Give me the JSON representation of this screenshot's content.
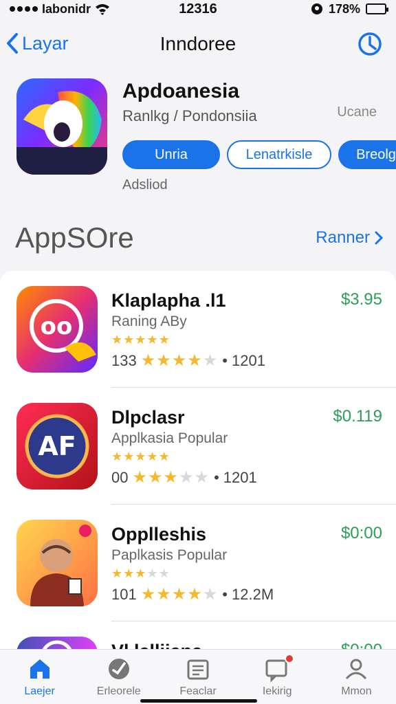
{
  "status_bar": {
    "carrier": "Iabonidr",
    "time": "12316",
    "battery": "178%",
    "battery_level": 0.9
  },
  "nav": {
    "back_label": "Layar",
    "title": "Inndoree"
  },
  "featured": {
    "name": "Apdoanesia",
    "subtitle": "Ranlkg / Pondonsiia",
    "extra": "Ucane",
    "buttons": [
      "Unria",
      "Lenatrkisle",
      "Breolg"
    ],
    "added": "Adsliod"
  },
  "section": {
    "title": "AppSOre",
    "see_all": "Ranner"
  },
  "apps": [
    {
      "name": "Klaplapha .l1",
      "category": "Raning ABy",
      "price": "$3.95",
      "stars_small": 5,
      "count": "133",
      "stars": 3.5,
      "reviews": "1201"
    },
    {
      "name": "Dlpclasr",
      "category": "Applkasia Popular",
      "price": "$0.119",
      "stars_small": 5,
      "count": "00",
      "stars": 2.5,
      "reviews": "1201"
    },
    {
      "name": "Opplleshis",
      "category": "Paplkasis Popular",
      "price": "$0:00",
      "stars_small": 3,
      "count": "101",
      "stars": 3.5,
      "reviews": "12.2M"
    },
    {
      "name": "Vl lelliiene",
      "category": "",
      "price": "$0:00"
    }
  ],
  "tabs": [
    {
      "label": "Laejer",
      "icon": "home-icon",
      "active": true
    },
    {
      "label": "Erleorele",
      "icon": "explore-icon"
    },
    {
      "label": "Feaclar",
      "icon": "news-icon"
    },
    {
      "label": "Iekirig",
      "icon": "inbox-icon",
      "badge": true
    },
    {
      "label": "Mmon",
      "icon": "profile-icon"
    }
  ],
  "colors": {
    "accent": "#1a73e8",
    "price": "#2e9e57",
    "star": "#f5b82e"
  }
}
